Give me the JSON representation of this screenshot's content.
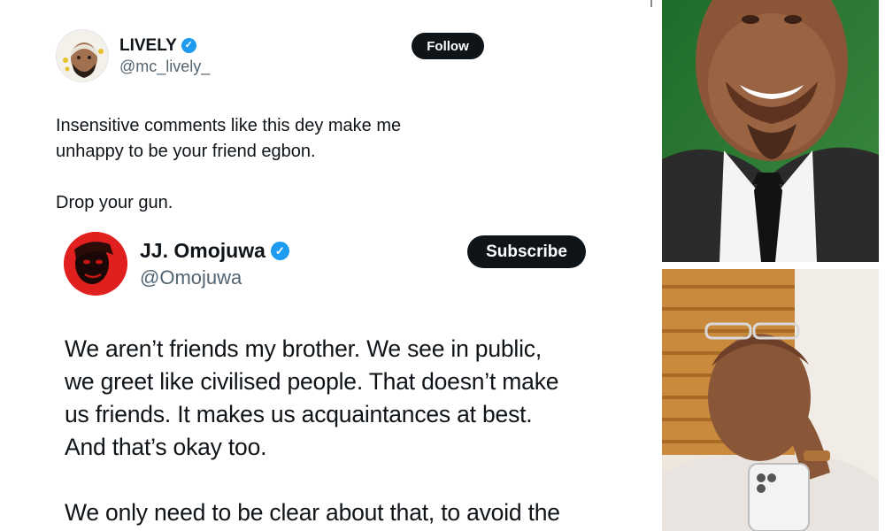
{
  "outer_post": {
    "author_name": "LIVELY",
    "author_handle": "@mc_lively_",
    "follow_label": "Follow",
    "paragraphs": [
      "Insensitive comments like this dey make me\nunhappy to be your friend egbon.",
      "Drop your gun."
    ]
  },
  "quoted_post": {
    "author_name": "JJ. Omojuwa",
    "author_handle": "@Omojuwa",
    "subscribe_label": "Subscribe",
    "paragraphs": [
      "We aren’t friends my brother. We see in public,\nwe greet like civilised people. That doesn’t make\nus friends. It makes us acquaintances at best.\nAnd that’s okay too.",
      "We only need to be clear about that, to avoid the"
    ]
  },
  "icons": {
    "verified": "verified-badge-icon"
  },
  "colors": {
    "verified_blue": "#1d9bf0",
    "button_black": "#0f1419",
    "handle_gray": "#536471"
  }
}
